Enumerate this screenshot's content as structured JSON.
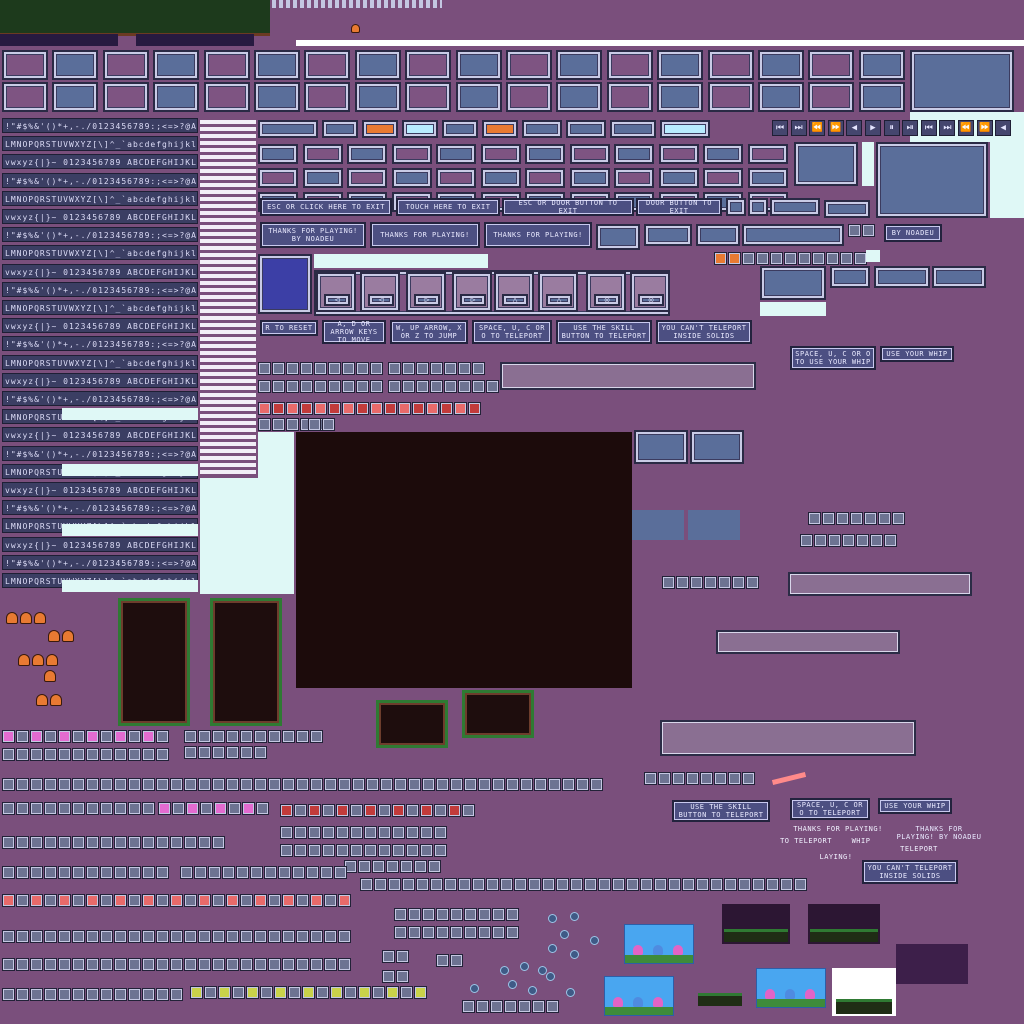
{
  "labels": {
    "esc_exit": "ESC OR CLICK HERE TO EXIT",
    "touch_exit": "TOUCH HERE TO EXIT",
    "esc_door": "ESC OR DOOR BUTTON TO EXIT",
    "door_exit": "DOOR BUTTON TO EXIT",
    "thanks_by": "THANKS FOR PLAYING! BY NOADEU",
    "thanks": "THANKS FOR PLAYING!",
    "by_noadeu": "BY NOADEU",
    "r_reset": "R TO RESET",
    "ad_move": "A, D OR ARROW KEYS TO MOVE",
    "w_jump": "W, UP ARROW, X OR Z TO JUMP",
    "space_tp": "SPACE, U, C OR O TO TELEPORT",
    "skill_tp": "USE THE SKILL BUTTON TO TELEPORT",
    "cant_tp": "YOU CAN'T TELEPORT INSIDE SOLIDS",
    "space_whip": "SPACE, U, C OR O TO USE YOUR WHIP",
    "use_whip": "USE YOUR WHIP",
    "to_teleport": "TO TELEPORT",
    "whip": "WHIP",
    "teleport": "TELEPORT",
    "laying": "LAYING!"
  },
  "glyphs": {
    "row_a": "!\"#$%&'()*+,-./0123456789:;<=>?@ABCDEFGHIJK",
    "row_b": "LMNOPQRSTUVWXYZ[\\]^_`abcdefghijklmnopqrstu",
    "row_c": "vwxyz{|}~ 0123456789 ABCDEFGHIJKLMNOPQRST"
  },
  "media_icons": [
    "⏮",
    "⏭",
    "⏪",
    "⏩",
    "◀",
    "▶",
    "⏸",
    "⏯"
  ],
  "nav_arrows": [
    "◁",
    "◁",
    "▷",
    "▷",
    "△",
    "△"
  ],
  "colors": {
    "background": "#7a4f7c",
    "panel": "#5a6e9a",
    "accent_orange": "#e87a32",
    "accent_cyan": "#b8ecff",
    "grass": "#2f7a33"
  }
}
